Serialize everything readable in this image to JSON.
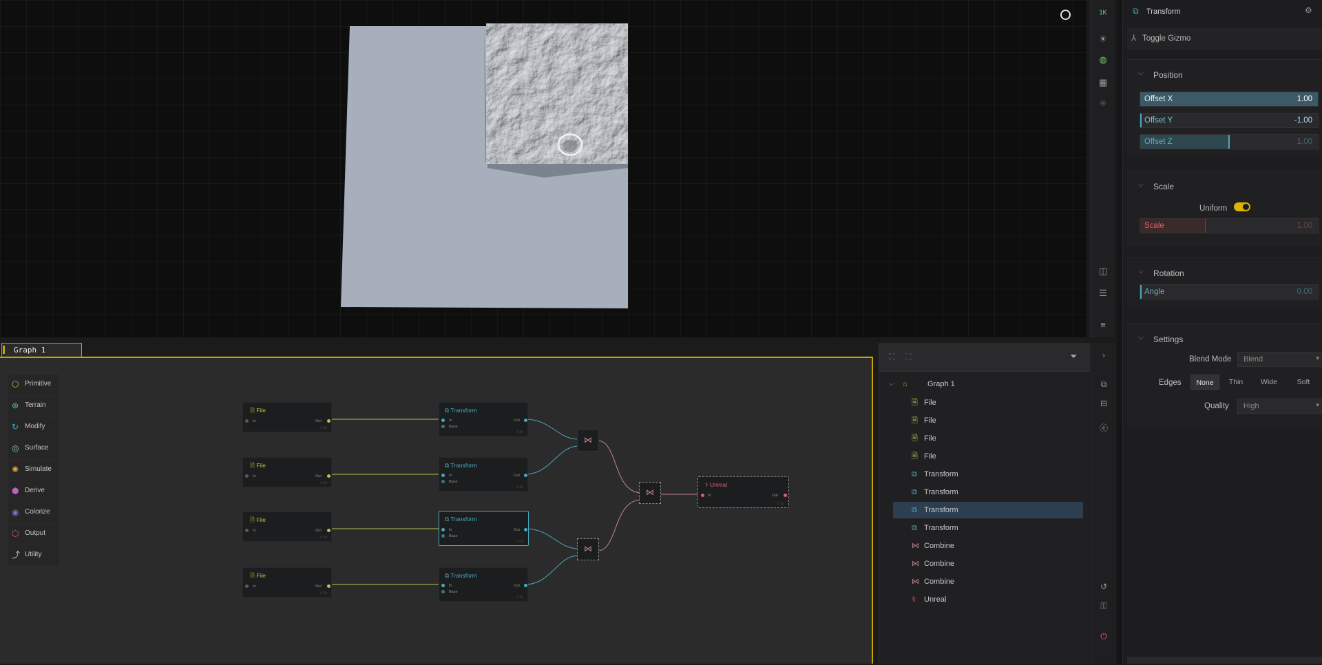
{
  "viewport": {
    "toolbar": {
      "resolution_label": "1K",
      "icons": [
        "resolution-badge",
        "sun-icon",
        "sphere-icon",
        "grid-icon",
        "camera-icon",
        "split-view-icon",
        "panel-icon",
        "menu-icon"
      ]
    }
  },
  "properties": {
    "title": "Transform",
    "toggle_gizmo": "Toggle Gizmo",
    "position": {
      "title": "Position",
      "offset_x": {
        "label": "Offset X",
        "value": "1.00",
        "fill_fraction": 1.0
      },
      "offset_y": {
        "label": "Offset Y",
        "value": "-1.00",
        "fill_fraction": 0.0
      },
      "offset_z": {
        "label": "Offset Z",
        "value": "1.00",
        "fill_fraction": 0.5
      }
    },
    "scale": {
      "title": "Scale",
      "uniform_label": "Uniform",
      "uniform_on": true,
      "scale": {
        "label": "Scale",
        "value": "1.00"
      }
    },
    "rotation": {
      "title": "Rotation",
      "angle": {
        "label": "Angle",
        "value": "0.00"
      }
    },
    "settings": {
      "title": "Settings",
      "blend_mode_label": "Blend Mode",
      "blend_mode_value": "Blend",
      "edges_label": "Edges",
      "edges_options": [
        "None",
        "Thin",
        "Wide",
        "Soft"
      ],
      "edges_selected": "None",
      "quality_label": "Quality",
      "quality_value": "High"
    }
  },
  "graph": {
    "tab_label": "Graph 1",
    "categories": [
      "Primitive",
      "Terrain",
      "Modify",
      "Surface",
      "Simulate",
      "Derive",
      "Colorize",
      "Output",
      "Utility"
    ],
    "nodes": {
      "file_title": "File",
      "transform_title": "Transform",
      "unreal_title": "Unreal",
      "pin_in": "In",
      "pin_out": "Out",
      "pin_base": "Base",
      "foot": "0.0s"
    }
  },
  "outliner": {
    "root": "Graph 1",
    "items": [
      {
        "label": "File",
        "type": "file"
      },
      {
        "label": "File",
        "type": "file"
      },
      {
        "label": "File",
        "type": "file"
      },
      {
        "label": "File",
        "type": "file"
      },
      {
        "label": "Transform",
        "type": "transform"
      },
      {
        "label": "Transform",
        "type": "transform"
      },
      {
        "label": "Transform",
        "type": "transform",
        "selected": true
      },
      {
        "label": "Transform",
        "type": "transform"
      },
      {
        "label": "Combine",
        "type": "combine"
      },
      {
        "label": "Combine",
        "type": "combine"
      },
      {
        "label": "Combine",
        "type": "combine"
      },
      {
        "label": "Unreal",
        "type": "unreal"
      }
    ]
  },
  "colors": {
    "accent_yellow": "#c8a400",
    "file_color": "#b9c34a",
    "transform_color": "#4aa8c0",
    "combine_color": "#c07080",
    "unreal_color": "#e06070",
    "selection_bg": "#2c3e50"
  }
}
